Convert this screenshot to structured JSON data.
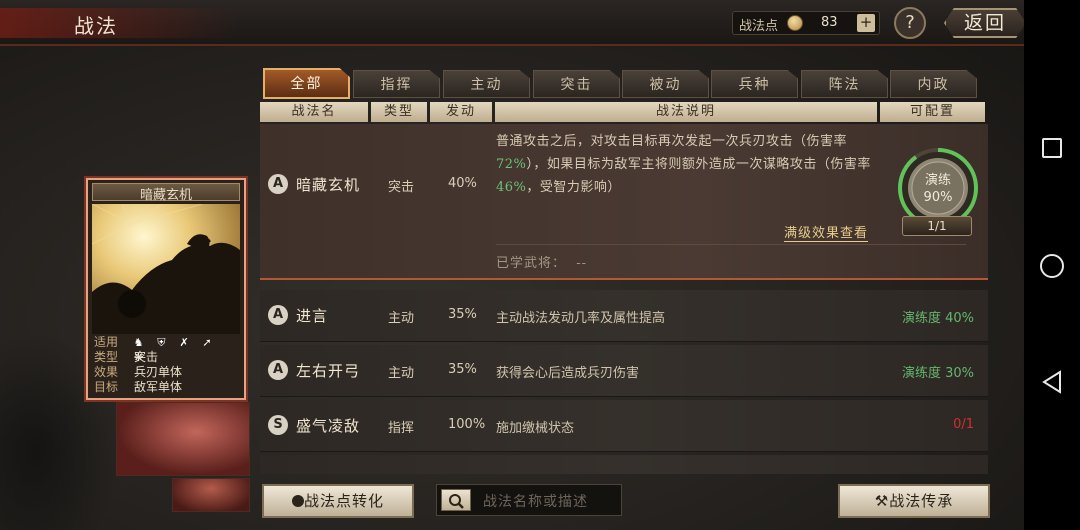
{
  "header": {
    "title": "战法",
    "points_label": "战法点",
    "points_value": "83",
    "plus_label": "+",
    "help_label": "?",
    "back_label": "返回"
  },
  "tabs": [
    {
      "label": "全部",
      "active": true
    },
    {
      "label": "指挥"
    },
    {
      "label": "主动"
    },
    {
      "label": "突击"
    },
    {
      "label": "被动"
    },
    {
      "label": "兵种"
    },
    {
      "label": "阵法"
    },
    {
      "label": "内政"
    }
  ],
  "columns": {
    "name": "战法名",
    "type": "类型",
    "rate": "发动",
    "desc": "战法说明",
    "config": "可配置"
  },
  "selected": {
    "badge": "A",
    "name": "暗藏玄机",
    "type": "突击",
    "rate": "40%",
    "desc_1": "普通攻击之后，对攻击目标再次发起一次兵刃攻击（伤害率",
    "desc_2": "72%",
    "desc_3": "），如果目标为敌军主将则额外造成一次谋略攻击（伤害率",
    "desc_4": "46%",
    "desc_5": "，受智力影响）",
    "full_max_link": "满级效果查看",
    "learned_label": "已学武将：",
    "learned_value": "--",
    "gauge_label": "演练",
    "gauge_value": "90%",
    "gauge_progress": 0.9,
    "level": "1/1"
  },
  "rows": [
    {
      "badge": "A",
      "name": "进言",
      "type": "主动",
      "rate": "35%",
      "desc": "主动战法发动几率及属性提高",
      "config": "演练度 40%",
      "config_color": "#66b56d"
    },
    {
      "badge": "A",
      "name": "左右开弓",
      "type": "主动",
      "rate": "35%",
      "desc": "获得会心后造成兵刃伤害",
      "config": "演练度 30%",
      "config_color": "#66b56d"
    },
    {
      "badge": "S",
      "name": "盛气凌敌",
      "type": "指挥",
      "rate": "100%",
      "desc": "施加缴械状态",
      "config": "0/1",
      "config_color": "#d0302c"
    }
  ],
  "card": {
    "name": "暗藏玄机",
    "keys": {
      "apply": "适用",
      "type": "类型",
      "effect": "效果",
      "target": "目标"
    },
    "type": "突击",
    "effect": "兵刃单体",
    "target": "敌军单体"
  },
  "bottom": {
    "convert_label": "战法点转化",
    "search_placeholder": "战法名称或描述",
    "inherit_label": "战法传承"
  }
}
